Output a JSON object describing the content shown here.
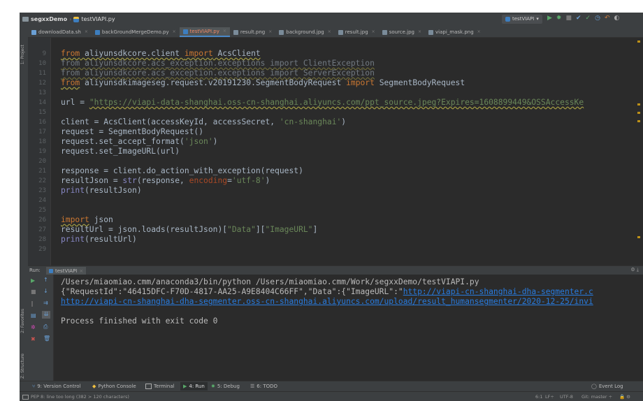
{
  "titlebar": {
    "project": "segxxDemo",
    "file": "testVIAPI.py",
    "run_config": "testVIAPI"
  },
  "tabs": [
    {
      "label": "downloadData.sh",
      "active": false
    },
    {
      "label": "backGroundMergeDemo.py",
      "active": false
    },
    {
      "label": "testVIAPI.py",
      "active": true
    },
    {
      "label": "result.png",
      "active": false
    },
    {
      "label": "background.jpg",
      "active": false
    },
    {
      "label": "result.jpg",
      "active": false
    },
    {
      "label": "source.jpg",
      "active": false
    },
    {
      "label": "viapi_mask.png",
      "active": false
    }
  ],
  "left_toolbar": {
    "project": "1: Project",
    "favorites": "2: Favorites",
    "structure": "Z: Structure"
  },
  "editor": {
    "line_numbers": [
      "9",
      "10",
      "11",
      "12",
      "13",
      "14",
      "15",
      "16",
      "17",
      "18",
      "19",
      "20",
      "21",
      "22",
      "23",
      "24",
      "25",
      "26",
      "27",
      "28",
      "29"
    ],
    "code": {
      "l9_a": "from",
      "l9_b": " aliyunsdkcore.client ",
      "l9_c": "import",
      "l9_d": " AcsClient",
      "l10": "from aliyunsdkcore.acs_exception.exceptions import ClientException",
      "l11": "from aliyunsdkcore.acs_exception.exceptions import ServerException",
      "l12_a": "from",
      "l12_b": " aliyunsdkimageseg.request.v20191230.SegmentBodyRequest ",
      "l12_c": "import",
      "l12_d": " SegmentBodyRequest",
      "l14_a": "url = ",
      "l14_b": "\"https://viapi-data-shanghai.oss-cn-shanghai.aliyuncs.com/ppt_source.jpeg?Expires=1608899449&OSSAccessKe",
      "l16_a": "client = AcsClient(accessKeyId, accessSecret, ",
      "l16_b": "'cn-shanghai'",
      "l16_c": ")",
      "l17": "request = SegmentBodyRequest()",
      "l18_a": "request.set_accept_format(",
      "l18_b": "'json'",
      "l18_c": ")",
      "l19": "request.set_ImageURL(url)",
      "l21": "response = client.do_action_with_exception(request)",
      "l22_a": "resultJson = ",
      "l22_b": "str",
      "l22_c": "(response, ",
      "l22_d": "encoding",
      "l22_e": "=",
      "l22_f": "'utf-8'",
      "l22_g": ")",
      "l23_a": "print",
      "l23_b": "(resultJson)",
      "l27_a": "import",
      "l27_b": " json",
      "l28_a": "resultUrl = json.loads(resultJson)[",
      "l28_b": "\"Data\"",
      "l28_c": "][",
      "l28_d": "\"ImageURL\"",
      "l28_e": "]",
      "l29_a": "print",
      "l29_b": "(resultUrl)"
    }
  },
  "run_panel": {
    "run_label": "Run:",
    "config": "testVIAPI",
    "output": {
      "cmd": "/Users/miaomiao.cmm/anaconda3/bin/python /Users/miaomiao.cmm/Work/segxxDemo/testVIAPI.py",
      "json_prefix": "{\"RequestId\":\"46415DFC-F70D-4817-AA25-A9E8404C66FF\",\"Data\":{\"ImageURL\":\"",
      "json_link": "http://viapi-cn-shanghai-dha-segmenter.c",
      "url_line": "http://viapi-cn-shanghai-dha-segmenter.oss-cn-shanghai.aliyuncs.com/upload/result_humansegmenter/2020-12-25/invi",
      "exit": "Process finished with exit code 0"
    }
  },
  "bottom_toolbar": {
    "version_control": "9: Version Control",
    "python_console": "Python Console",
    "terminal": "Terminal",
    "run": "4: Run",
    "debug": "5: Debug",
    "todo": "6: TODO",
    "event_log": "Event Log"
  },
  "statusbar": {
    "message": "PEP 8: line too long (382 > 120 characters)",
    "position": "6:1",
    "line_sep": "LF÷",
    "encoding": "UTF-8",
    "git": "Git: master ÷"
  },
  "colors": {
    "bg": "#2b2b2b",
    "keyword": "#cc7832",
    "string": "#6a8759",
    "link": "#287bde",
    "run_green": "#59a869"
  }
}
